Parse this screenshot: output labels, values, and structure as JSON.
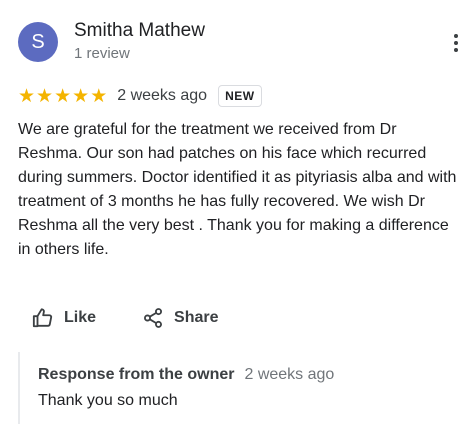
{
  "review": {
    "avatar_letter": "S",
    "avatar_color": "#5c6bc0",
    "reviewer_name": "Smitha Mathew",
    "review_count": "1 review",
    "rating": 5,
    "rating_max": 5,
    "time": "2 weeks ago",
    "badge": "NEW",
    "text": "We are grateful for the treatment we received from Dr Reshma. Our son had patches on his face which recurred during summers. Doctor identified it as pityriasis alba and with treatment of 3 months he has fully recovered. We wish Dr Reshma all the very best . Thank you for making a difference in others life.",
    "star_color": "#f4b400"
  },
  "actions": {
    "like_label": "Like",
    "like_icon": "thumbs-up-icon",
    "share_label": "Share",
    "share_icon": "share-icon"
  },
  "owner_response": {
    "title": "Response from the owner",
    "time": "2 weeks ago",
    "text": "Thank you so much"
  }
}
